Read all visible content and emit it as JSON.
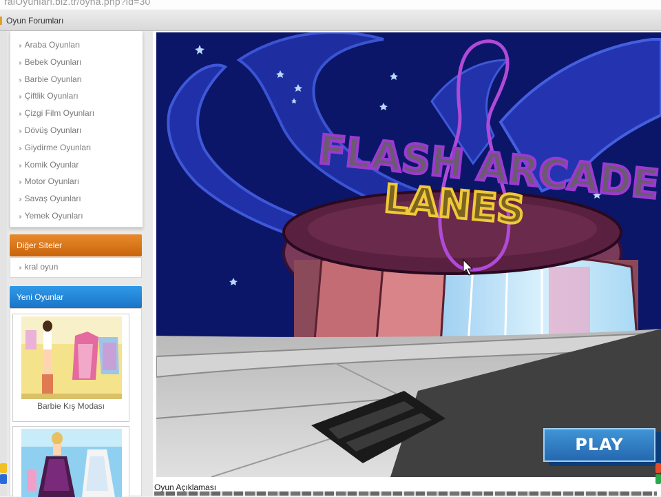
{
  "browser": {
    "url_fragment": "ralOyunlari.biz.tr/oyna.php?id=30"
  },
  "topnav": {
    "forum_link": "Oyun Forumları"
  },
  "sidebar": {
    "categories": [
      "Araba Oyunları",
      "Bebek Oyunları",
      "Barbie Oyunları",
      "Çiftlik Oyunları",
      "Çizgi Film Oyunları",
      "Dövüş Oyunları",
      "Giydirme Oyunları",
      "Komik Oyunlar",
      "Motor Oyunları",
      "Savaş Oyunları",
      "Yemek Oyunları"
    ],
    "other_sites_header": "Diğer Siteler",
    "other_sites": [
      "kral oyun"
    ],
    "new_games_header": "Yeni Oyunlar",
    "new_games": [
      "Barbie Kış Modası"
    ]
  },
  "game": {
    "title_line1": "FLASH ARCADE",
    "title_line2": "LANES",
    "play_label": "PLAY"
  },
  "description": {
    "label": "Oyun Açıklaması"
  },
  "colors": {
    "orange_header": "#d9731a",
    "blue_header": "#2385d8",
    "play_button": "#2e7bc4",
    "sky": "#0b1466"
  }
}
